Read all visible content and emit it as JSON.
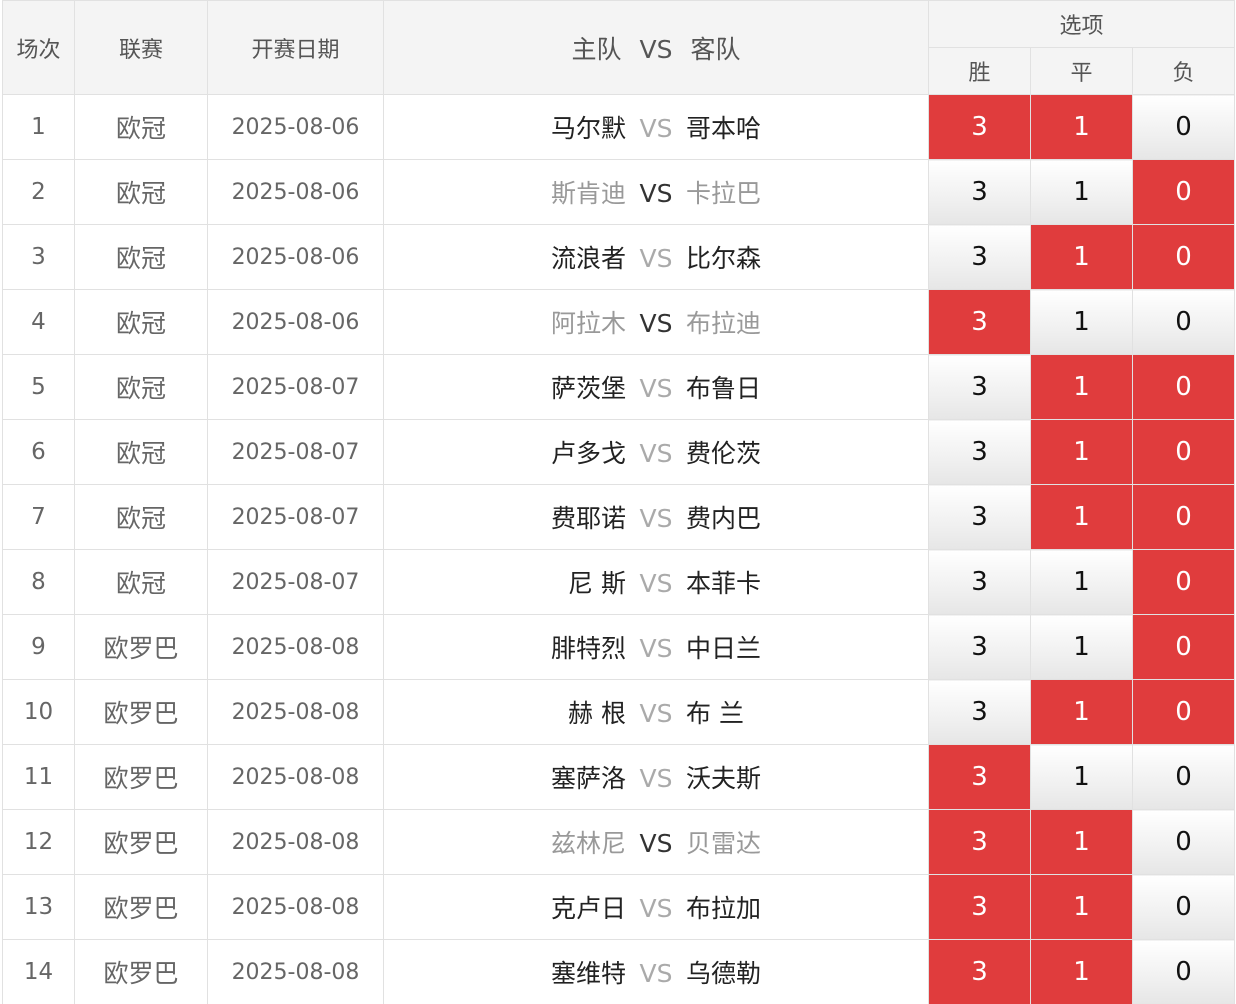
{
  "header": {
    "col_match": "场次",
    "col_league": "联赛",
    "col_date": "开赛日期",
    "col_home": "主队",
    "col_vs": "VS",
    "col_away": "客队",
    "col_options": "选项",
    "opt_win": "胜",
    "opt_draw": "平",
    "opt_lose": "负"
  },
  "rows": [
    {
      "num": "1",
      "league": "欧冠",
      "date": "2025-08-06",
      "home": "马尔默",
      "vs": "VS",
      "away": "哥本哈",
      "win": "3",
      "draw": "1",
      "lose": "0",
      "win_sel": true,
      "draw_sel": true,
      "lose_sel": false,
      "dim": false
    },
    {
      "num": "2",
      "league": "欧冠",
      "date": "2025-08-06",
      "home": "斯肯迪",
      "vs": "VS",
      "away": "卡拉巴",
      "win": "3",
      "draw": "1",
      "lose": "0",
      "win_sel": false,
      "draw_sel": false,
      "lose_sel": true,
      "dim": true
    },
    {
      "num": "3",
      "league": "欧冠",
      "date": "2025-08-06",
      "home": "流浪者",
      "vs": "VS",
      "away": "比尔森",
      "win": "3",
      "draw": "1",
      "lose": "0",
      "win_sel": false,
      "draw_sel": true,
      "lose_sel": true,
      "dim": false
    },
    {
      "num": "4",
      "league": "欧冠",
      "date": "2025-08-06",
      "home": "阿拉木",
      "vs": "VS",
      "away": "布拉迪",
      "win": "3",
      "draw": "1",
      "lose": "0",
      "win_sel": true,
      "draw_sel": false,
      "lose_sel": false,
      "dim": true
    },
    {
      "num": "5",
      "league": "欧冠",
      "date": "2025-08-07",
      "home": "萨茨堡",
      "vs": "VS",
      "away": "布鲁日",
      "win": "3",
      "draw": "1",
      "lose": "0",
      "win_sel": false,
      "draw_sel": true,
      "lose_sel": true,
      "dim": false
    },
    {
      "num": "6",
      "league": "欧冠",
      "date": "2025-08-07",
      "home": "卢多戈",
      "vs": "VS",
      "away": "费伦茨",
      "win": "3",
      "draw": "1",
      "lose": "0",
      "win_sel": false,
      "draw_sel": true,
      "lose_sel": true,
      "dim": false
    },
    {
      "num": "7",
      "league": "欧冠",
      "date": "2025-08-07",
      "home": "费耶诺",
      "vs": "VS",
      "away": "费内巴",
      "win": "3",
      "draw": "1",
      "lose": "0",
      "win_sel": false,
      "draw_sel": true,
      "lose_sel": true,
      "dim": false
    },
    {
      "num": "8",
      "league": "欧冠",
      "date": "2025-08-07",
      "home": "尼 斯",
      "vs": "VS",
      "away": "本菲卡",
      "win": "3",
      "draw": "1",
      "lose": "0",
      "win_sel": false,
      "draw_sel": false,
      "lose_sel": true,
      "dim": false
    },
    {
      "num": "9",
      "league": "欧罗巴",
      "date": "2025-08-08",
      "home": "腓特烈",
      "vs": "VS",
      "away": "中日兰",
      "win": "3",
      "draw": "1",
      "lose": "0",
      "win_sel": false,
      "draw_sel": false,
      "lose_sel": true,
      "dim": false
    },
    {
      "num": "10",
      "league": "欧罗巴",
      "date": "2025-08-08",
      "home": "赫 根",
      "vs": "VS",
      "away": "布 兰",
      "win": "3",
      "draw": "1",
      "lose": "0",
      "win_sel": false,
      "draw_sel": true,
      "lose_sel": true,
      "dim": false
    },
    {
      "num": "11",
      "league": "欧罗巴",
      "date": "2025-08-08",
      "home": "塞萨洛",
      "vs": "VS",
      "away": "沃夫斯",
      "win": "3",
      "draw": "1",
      "lose": "0",
      "win_sel": true,
      "draw_sel": false,
      "lose_sel": false,
      "dim": false
    },
    {
      "num": "12",
      "league": "欧罗巴",
      "date": "2025-08-08",
      "home": "兹林尼",
      "vs": "VS",
      "away": "贝雷达",
      "win": "3",
      "draw": "1",
      "lose": "0",
      "win_sel": true,
      "draw_sel": true,
      "lose_sel": false,
      "dim": true
    },
    {
      "num": "13",
      "league": "欧罗巴",
      "date": "2025-08-08",
      "home": "克卢日",
      "vs": "VS",
      "away": "布拉加",
      "win": "3",
      "draw": "1",
      "lose": "0",
      "win_sel": true,
      "draw_sel": true,
      "lose_sel": false,
      "dim": false
    },
    {
      "num": "14",
      "league": "欧罗巴",
      "date": "2025-08-08",
      "home": "塞维特",
      "vs": "VS",
      "away": "乌德勒",
      "win": "3",
      "draw": "1",
      "lose": "0",
      "win_sel": true,
      "draw_sel": true,
      "lose_sel": false,
      "dim": false
    }
  ],
  "colors": {
    "selected": "#e03c3d",
    "header_bg": "#f4f4f4",
    "border": "#e1e1e1"
  }
}
